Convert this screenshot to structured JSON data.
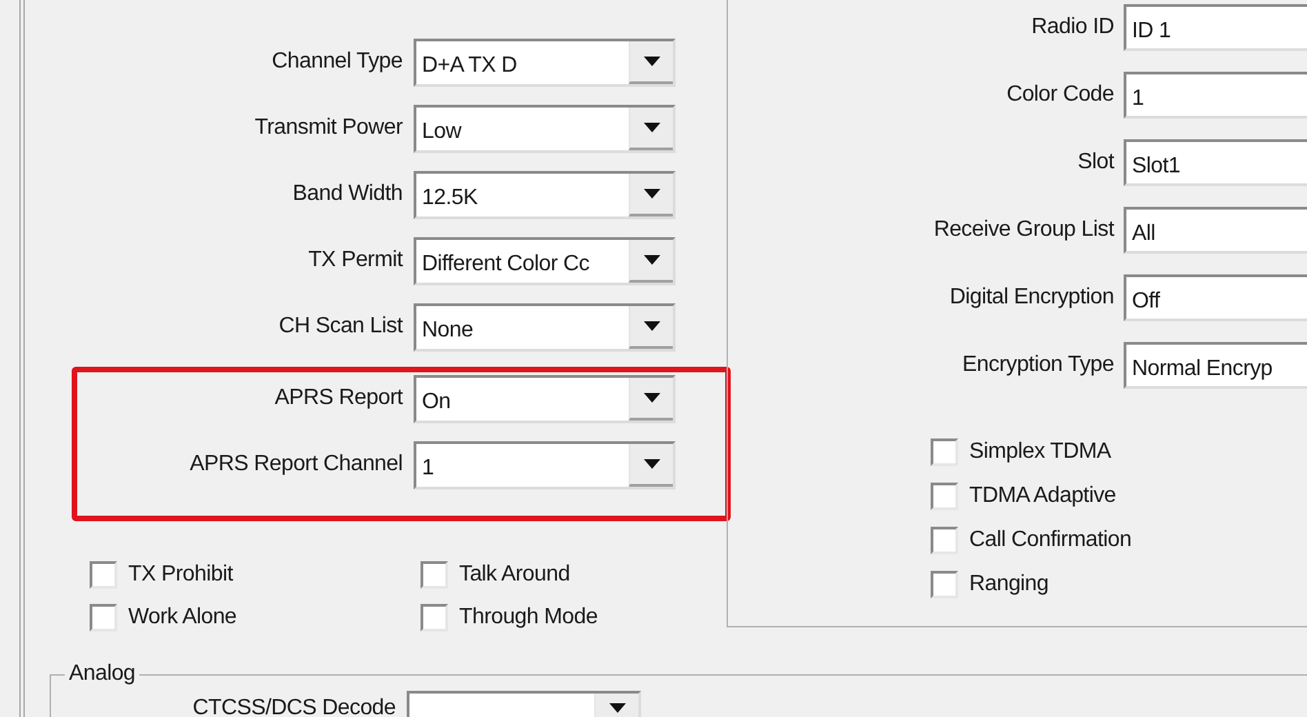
{
  "left_fields": [
    {
      "label": "Channel Type",
      "value": "D+A TX D",
      "highlighted": false
    },
    {
      "label": "Transmit Power",
      "value": "Low",
      "highlighted": false
    },
    {
      "label": "Band Width",
      "value": "12.5K",
      "highlighted": false
    },
    {
      "label": "TX Permit",
      "value": "Different Color Cc",
      "highlighted": false
    },
    {
      "label": "CH Scan List",
      "value": "None",
      "highlighted": false
    },
    {
      "label": "APRS Report",
      "value": "On",
      "highlighted": true
    },
    {
      "label": "APRS Report Channel",
      "value": "1",
      "highlighted": true
    }
  ],
  "left_checkboxes": [
    {
      "label": "TX Prohibit",
      "checked": false
    },
    {
      "label": "Talk Around",
      "checked": false
    },
    {
      "label": "Work Alone",
      "checked": false
    },
    {
      "label": "Through Mode",
      "checked": false
    }
  ],
  "right_fields": [
    {
      "label": "Radio ID",
      "value": "ID 1"
    },
    {
      "label": "Color Code",
      "value": "1"
    },
    {
      "label": "Slot",
      "value": "Slot1"
    },
    {
      "label": "Receive Group List",
      "value": "All"
    },
    {
      "label": "Digital Encryption",
      "value": "Off"
    },
    {
      "label": "Encryption Type",
      "value": "Normal Encryp"
    }
  ],
  "right_checkboxes": [
    {
      "label": "Simplex TDMA",
      "checked": false
    },
    {
      "label": "TDMA Adaptive",
      "checked": false
    },
    {
      "label": "Call Confirmation",
      "checked": false
    },
    {
      "label": "Ranging",
      "checked": false
    }
  ],
  "analog": {
    "title": "Analog",
    "fields": [
      {
        "label": "CTCSS/DCS Decode"
      }
    ]
  }
}
